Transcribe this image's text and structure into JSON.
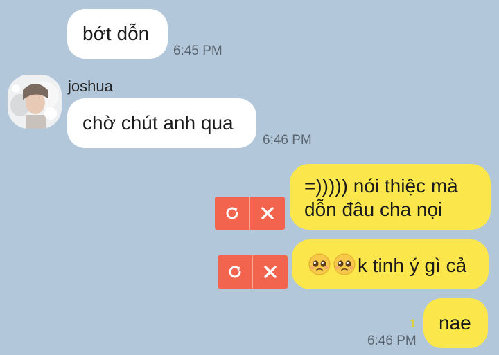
{
  "messages": [
    {
      "id": "m1",
      "side": "incoming",
      "text": "bớt dỗn",
      "time": "6:45 PM"
    },
    {
      "id": "m2",
      "side": "incoming",
      "sender": "joshua",
      "text": "chờ chút anh qua",
      "time": "6:46 PM"
    },
    {
      "id": "m3",
      "side": "outgoing",
      "line1": "=))))) nói thiệc mà",
      "line2": "dỗn đâu cha nọi",
      "status": "failed"
    },
    {
      "id": "m4",
      "side": "outgoing",
      "emojis": [
        "pleading-face",
        "pleading-face"
      ],
      "text": "k tinh ý gì cả",
      "status": "failed"
    },
    {
      "id": "m5",
      "side": "outgoing",
      "text": "nae",
      "unread_count": "1",
      "time": "6:46 PM"
    }
  ],
  "icons": {
    "retry": "retry-icon",
    "delete": "close-icon",
    "avatar": "avatar"
  },
  "colors": {
    "background": "#b3c7db",
    "incoming_bubble": "#ffffff",
    "outgoing_bubble": "#fbe74b",
    "failed_action": "#f3644e",
    "unread": "#e8cf1d"
  }
}
